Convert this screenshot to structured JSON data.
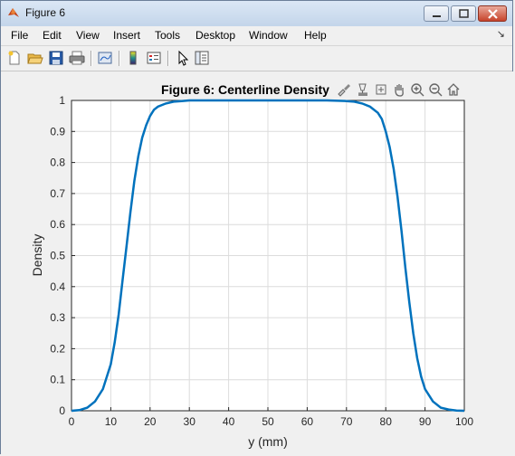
{
  "window": {
    "title": "Figure 6"
  },
  "menu": {
    "items": [
      "File",
      "Edit",
      "View",
      "Insert",
      "Tools",
      "Desktop",
      "Window",
      "Help"
    ],
    "overflow": "↘"
  },
  "toolbar": {
    "icons": [
      "new-figure-icon",
      "open-file-icon",
      "save-icon",
      "print-icon",
      "link-plot-icon",
      "colorbar-icon",
      "legend-icon",
      "pointer-icon",
      "property-inspector-icon"
    ]
  },
  "axes_toolbar": {
    "icons": [
      "brush-icon",
      "data-tips-icon",
      "rotate-icon",
      "pan-icon",
      "zoom-in-icon",
      "zoom-out-icon",
      "home-icon"
    ]
  },
  "chart_data": {
    "type": "line",
    "title": "Figure 6: Centerline Density",
    "xlabel": "y (mm)",
    "ylabel": "Density",
    "xlim": [
      0,
      100
    ],
    "ylim": [
      0,
      1
    ],
    "xticks": [
      "0",
      "10",
      "20",
      "30",
      "40",
      "50",
      "60",
      "70",
      "80",
      "90",
      "100"
    ],
    "yticks": [
      "0",
      "0.1",
      "0.2",
      "0.3",
      "0.4",
      "0.5",
      "0.6",
      "0.7",
      "0.8",
      "0.9",
      "1"
    ],
    "grid": true,
    "series_color": "#0072bd",
    "x": [
      0,
      2,
      4,
      6,
      8,
      10,
      11,
      12,
      13,
      14,
      15,
      16,
      17,
      18,
      19,
      20,
      21,
      22,
      24,
      26,
      28,
      30,
      35,
      40,
      50,
      60,
      65,
      70,
      72,
      74,
      76,
      78,
      79,
      80,
      81,
      82,
      83,
      84,
      85,
      86,
      87,
      88,
      89,
      90,
      92,
      94,
      96,
      98,
      100
    ],
    "y": [
      0,
      0.002,
      0.01,
      0.03,
      0.07,
      0.15,
      0.22,
      0.31,
      0.42,
      0.53,
      0.64,
      0.74,
      0.82,
      0.88,
      0.92,
      0.95,
      0.97,
      0.98,
      0.99,
      0.996,
      0.998,
      1.0,
      1.0,
      1.0,
      1.0,
      1.0,
      1.0,
      0.998,
      0.996,
      0.99,
      0.98,
      0.96,
      0.94,
      0.9,
      0.85,
      0.78,
      0.69,
      0.58,
      0.46,
      0.35,
      0.25,
      0.17,
      0.11,
      0.07,
      0.03,
      0.01,
      0.004,
      0.001,
      0
    ]
  }
}
